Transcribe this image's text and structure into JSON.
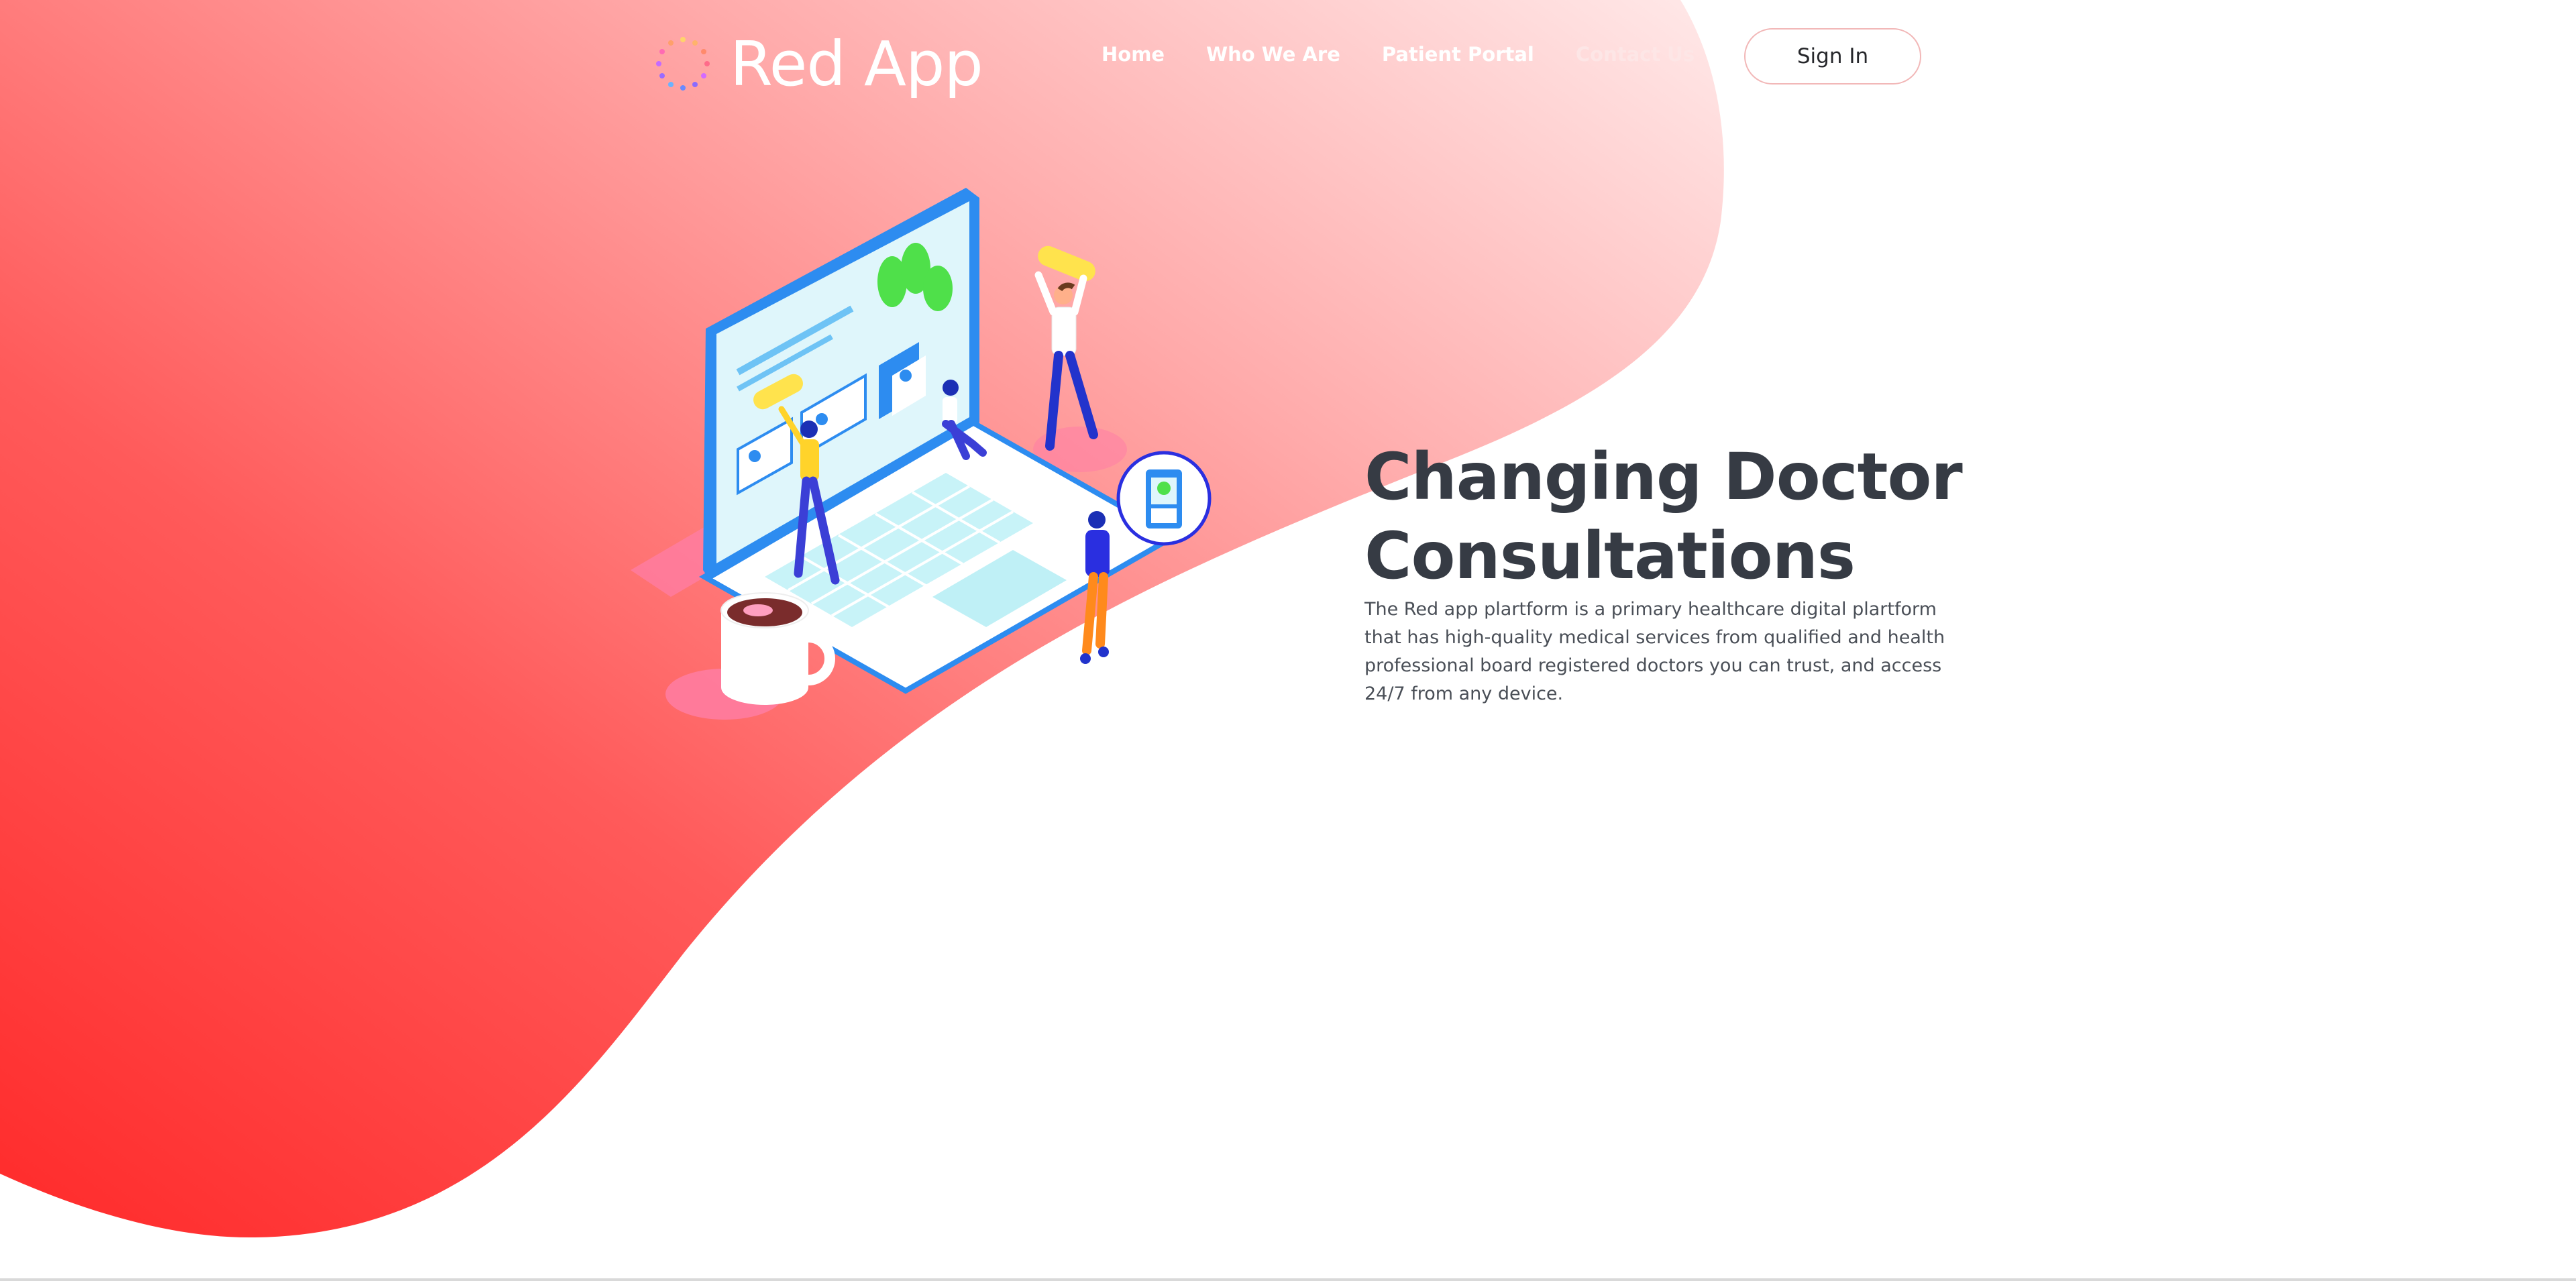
{
  "header": {
    "logo_text": "Red App",
    "logo_icon": "dotted-circle-logo-icon",
    "nav": [
      {
        "label": "Home"
      },
      {
        "label": "Who We Are"
      },
      {
        "label": "Patient Portal"
      },
      {
        "label": "Contact Us"
      }
    ],
    "signin_label": "Sign In"
  },
  "hero": {
    "title_line1": "Changing Doctor",
    "title_line2": "Consultations",
    "description": "The Red app plartform is a primary healthcare digital plartform that has high-quality medical services from qualified and health professional board registered doctors you can trust, and access 24/7 from any device.",
    "illustration": "isometric-laptop-people-illustration"
  },
  "colors": {
    "brand_red": "#ff2a2a",
    "blob_light": "#ffe6e6",
    "title_text": "#363b44",
    "body_text": "#4a4f57"
  }
}
